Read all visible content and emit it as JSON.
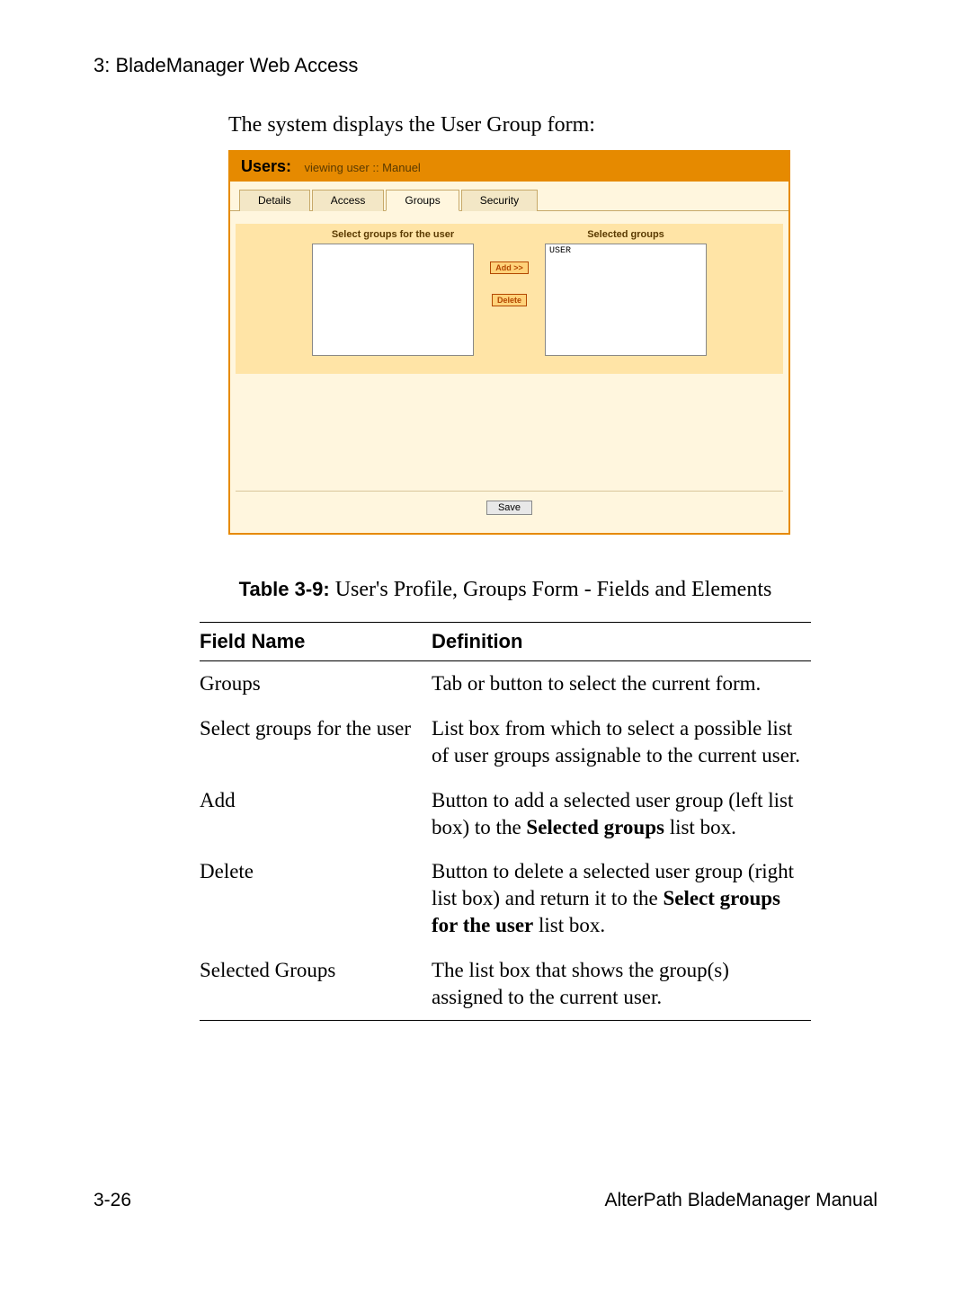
{
  "page": {
    "chapter_heading": "3: BladeManager Web Access",
    "intro_line": "The system displays the User Group form:",
    "page_number": "3-26",
    "manual_name": "AlterPath BladeManager Manual"
  },
  "panel": {
    "title_label": "Users:",
    "viewing_text": "viewing user  ::  Manuel",
    "tabs": {
      "details": "Details",
      "access": "Access",
      "groups": "Groups",
      "security": "Security"
    },
    "left_col_label": "Select groups for the user",
    "right_col_label": "Selected groups",
    "selected_items": [
      "USER"
    ],
    "add_btn": "Add >>",
    "delete_btn": "Delete",
    "save_btn": "Save"
  },
  "caption": {
    "table_number": "Table 3-9:",
    "table_title": " User's Profile, Groups Form - Fields and Elements"
  },
  "table": {
    "head_field": "Field Name",
    "head_def": "Definition",
    "rows": [
      {
        "field": "Groups",
        "def_plain": "Tab or button to select the current form."
      },
      {
        "field": "Select groups for the user",
        "def_plain": "List box from which to select a possible list of user groups assignable to the current user."
      },
      {
        "field": "Add",
        "def_pre": "Button to add a selected user group (left list box) to the ",
        "def_bold": "Selected groups",
        "def_post": " list box."
      },
      {
        "field": "Delete",
        "def_pre": "Button to delete a selected user group (right list box) and return it to the ",
        "def_bold": "Select groups for the user",
        "def_post": " list box."
      },
      {
        "field": "Selected Groups",
        "def_plain": "The list box that shows the group(s) assigned to the current user."
      }
    ]
  }
}
